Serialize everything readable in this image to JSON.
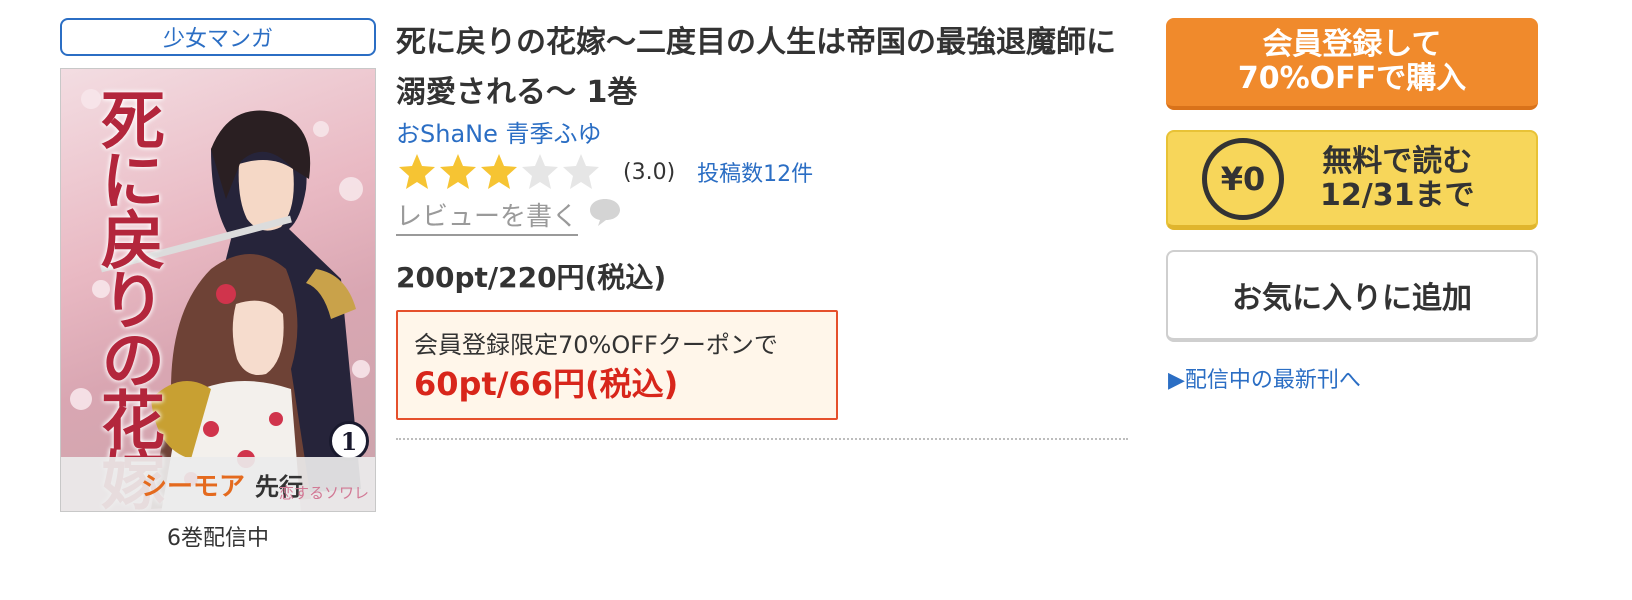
{
  "genre": "少女マンガ",
  "cover": {
    "title_text": "死に戻りの花嫁",
    "volume_mark": "1",
    "band_logo": "シーモア",
    "band_sub": "先行",
    "band_mark": "恋するソワレ"
  },
  "volume_count": "6巻配信中",
  "title": "死に戻りの花嫁〜二度目の人生は帝国の最強退魔師に溺愛される〜 1巻",
  "author": "おShaNe 青季ふゆ",
  "rating": {
    "score": 3.0,
    "max": 5,
    "score_label": "(3.0)",
    "review_count": "投稿数12件",
    "star_color": "#f6c433",
    "star_empty_color": "#e6e6e6"
  },
  "write_review": "レビューを書く",
  "price": "200pt/220円(税込)",
  "coupon": {
    "label": "会員登録限定70%OFFクーポンで",
    "price": "60pt/66円(税込)"
  },
  "buttons": {
    "buy": "会員登録して\n70%OFFで購入",
    "free_icon": "¥0",
    "free": "無料で読む\n12/31まで",
    "favorite": "お気に入りに追加"
  },
  "latest_link": "▶配信中の最新刊へ",
  "colors": {
    "link": "#2b6ec4",
    "buy_button": "#f08a2c",
    "free_button": "#f7d65a",
    "coupon_price": "#d8261b"
  }
}
